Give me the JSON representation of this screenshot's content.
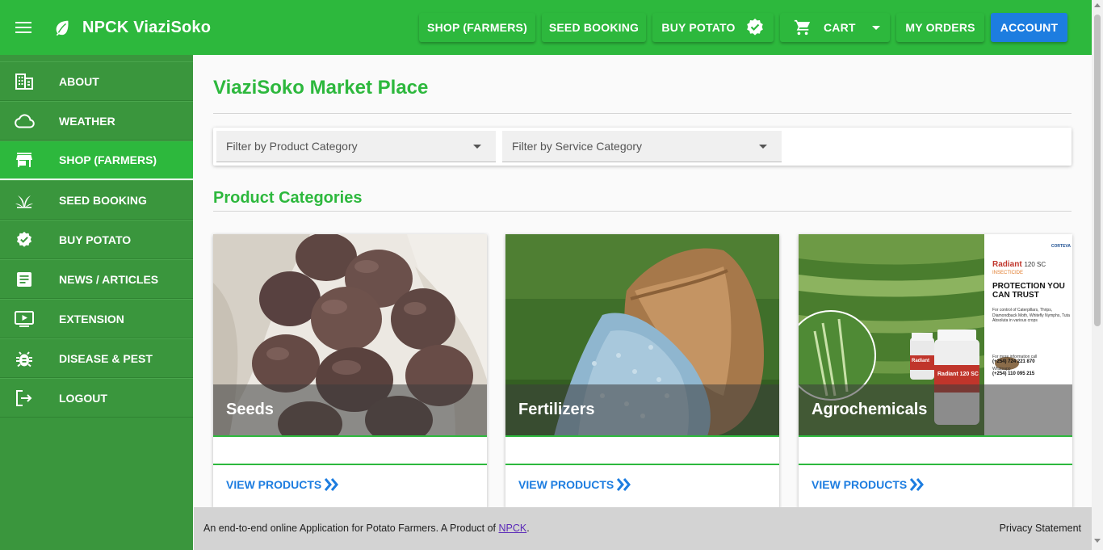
{
  "app": {
    "title": "NPCK ViaziSoko",
    "menu_icon": "hamburger-menu-icon",
    "logo_icon": "leaf-icon"
  },
  "nav": {
    "shop": "SHOP (FARMERS)",
    "seed_booking": "SEED BOOKING",
    "buy_potato": "BUY POTATO",
    "cart": "CART",
    "my_orders": "MY ORDERS",
    "account": "ACCOUNT"
  },
  "sidebar": {
    "items": [
      {
        "label": "ABOUT",
        "icon": "building-icon"
      },
      {
        "label": "WEATHER",
        "icon": "cloud-icon"
      },
      {
        "label": "SHOP (FARMERS)",
        "icon": "store-icon"
      },
      {
        "label": "SEED BOOKING",
        "icon": "seedling-icon"
      },
      {
        "label": "BUY POTATO",
        "icon": "verified-badge-icon"
      },
      {
        "label": "NEWS / ARTICLES",
        "icon": "article-icon"
      },
      {
        "label": "EXTENSION",
        "icon": "video-icon"
      },
      {
        "label": "DISEASE & PEST",
        "icon": "bug-icon"
      },
      {
        "label": "LOGOUT",
        "icon": "logout-icon"
      }
    ],
    "active": "SHOP (FARMERS)"
  },
  "main": {
    "page_title": "ViaziSoko Market Place",
    "filters": {
      "product_placeholder": "Filter by Product Category",
      "service_placeholder": "Filter by Service Category"
    },
    "section_title": "Product Categories",
    "categories": [
      {
        "title": "Seeds",
        "link": "VIEW PRODUCTS"
      },
      {
        "title": "Fertilizers",
        "link": "VIEW PRODUCTS"
      },
      {
        "title": "Agrochemicals",
        "link": "VIEW PRODUCTS"
      }
    ],
    "agro_ad": {
      "brand": "CORTEVA",
      "product": "Radiant",
      "product_suffix": "120 SC",
      "type": "INSECTICIDE",
      "headline": "PROTECTION YOU CAN TRUST",
      "body": "For control of Caterpillars, Thrips, Diamondback Moth, Whitefly Nymphs, Tuta Absoluta in various crops",
      "contact_label": "For more information call",
      "phone1": "(+254) 724 221 870",
      "whatsapp_label": "Whatsapp",
      "phone2": "(+254) 110 095 215",
      "label_bottle1": "Radiant",
      "label_bottle2": "Radiant 120 SC"
    }
  },
  "footer": {
    "text_before": "An end-to-end online Application for Potato Farmers. A Product of ",
    "link": "NPCK",
    "text_after": ".",
    "privacy": "Privacy Statement"
  },
  "colors": {
    "primary_green": "#2db83d",
    "sidebar_green": "#3a963d",
    "accent_blue": "#1d7de0",
    "footer_gray": "#d3d3d3"
  }
}
